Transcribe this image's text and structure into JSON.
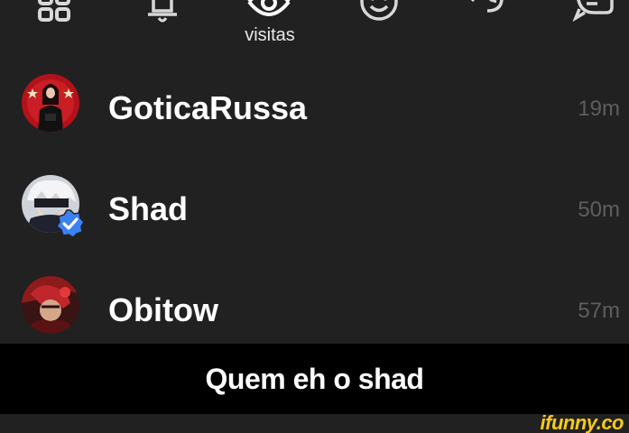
{
  "tabs": [
    {
      "icon": "grid-icon"
    },
    {
      "icon": "bell-icon"
    },
    {
      "icon": "eye-icon",
      "label": "visitas"
    },
    {
      "icon": "smiley-icon"
    },
    {
      "icon": "history-icon"
    },
    {
      "icon": "chat-icon"
    }
  ],
  "visitors": [
    {
      "name": "GoticaRussa",
      "time": "19m",
      "verified": false
    },
    {
      "name": "Shad",
      "time": "50m",
      "verified": true
    },
    {
      "name": "Obitow",
      "time": "57m",
      "verified": false
    }
  ],
  "caption": "Quem eh o shad",
  "watermark": "ifunny.co",
  "colors": {
    "background": "#212121",
    "icon": "#d8d8d8",
    "time": "#5e5e5e",
    "verified": "#3b82f6",
    "watermark": "#f6cc14"
  }
}
